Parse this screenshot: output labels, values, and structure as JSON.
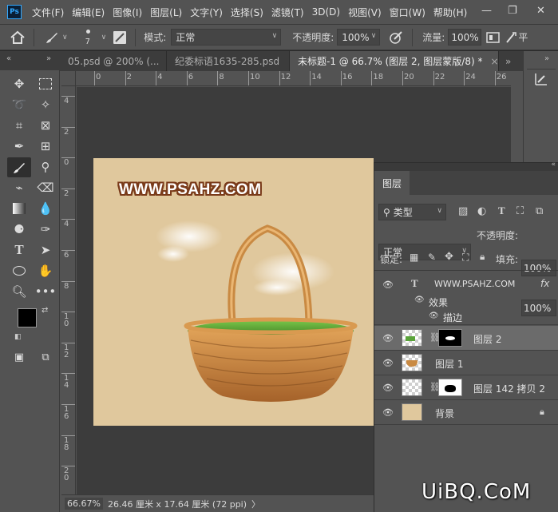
{
  "menu": {
    "logo": "Ps",
    "items": [
      "文件(F)",
      "编辑(E)",
      "图像(I)",
      "图层(L)",
      "文字(Y)",
      "选择(S)",
      "滤镜(T)",
      "3D(D)",
      "视图(V)",
      "窗口(W)",
      "帮助(H)"
    ],
    "min": "—",
    "restore": "❐",
    "close": "✕"
  },
  "options": {
    "brush_size": "7",
    "mode_label": "模式:",
    "mode_value": "正常",
    "opacity_label": "不透明度:",
    "opacity_value": "100%",
    "flow_label": "流量:",
    "flow_value": "100%",
    "extra": "平"
  },
  "tabs": [
    {
      "label": "05.psd @ 200% (..."
    },
    {
      "label": "纪委标语1635-285.psd"
    },
    {
      "label": "未标题-1 @ 66.7% (图层 2, 图层蒙版/8) *"
    }
  ],
  "tab_close": "×",
  "tab_more": "»",
  "ruler_h": [
    "0",
    "2",
    "4",
    "6",
    "8",
    "10",
    "12",
    "14",
    "16",
    "18",
    "20",
    "22",
    "24",
    "26"
  ],
  "ruler_v": [
    "4",
    "2",
    "0",
    "2",
    "4",
    "6",
    "8",
    "1\n0",
    "1\n2",
    "1\n4",
    "1\n6",
    "1\n8",
    "2\n0"
  ],
  "canvas": {
    "watermark": "WWW.PSAHZ.COM"
  },
  "colors": {
    "foreground": "#000000",
    "background": "#ffffff",
    "doc_bg": "#e0c89d"
  },
  "layers_panel": {
    "tab": "图层",
    "filter_label": "类型",
    "blend_mode": "正常",
    "opacity_label": "不透明度:",
    "opacity_value": "100%",
    "lock_label": "锁定:",
    "fill_label": "填充:",
    "fill_value": "100%",
    "layers": [
      {
        "name": "WWW.PSAHZ.COM",
        "type": "text",
        "fx": "fx"
      },
      {
        "name": "效果",
        "type": "effect"
      },
      {
        "name": "描边",
        "type": "effect-item"
      },
      {
        "name": "图层 2",
        "type": "masked",
        "selected": true
      },
      {
        "name": "图层 1",
        "type": "pixel"
      },
      {
        "name": "图层 142 拷贝 2",
        "type": "masked"
      },
      {
        "name": "背景",
        "type": "background"
      }
    ]
  },
  "status": {
    "zoom": "66.67%",
    "doc_size": "26.46 厘米 x 17.64 厘米 (72 ppi)",
    "arrow": "〉"
  },
  "watermark_site": "UiBQ.CoM"
}
